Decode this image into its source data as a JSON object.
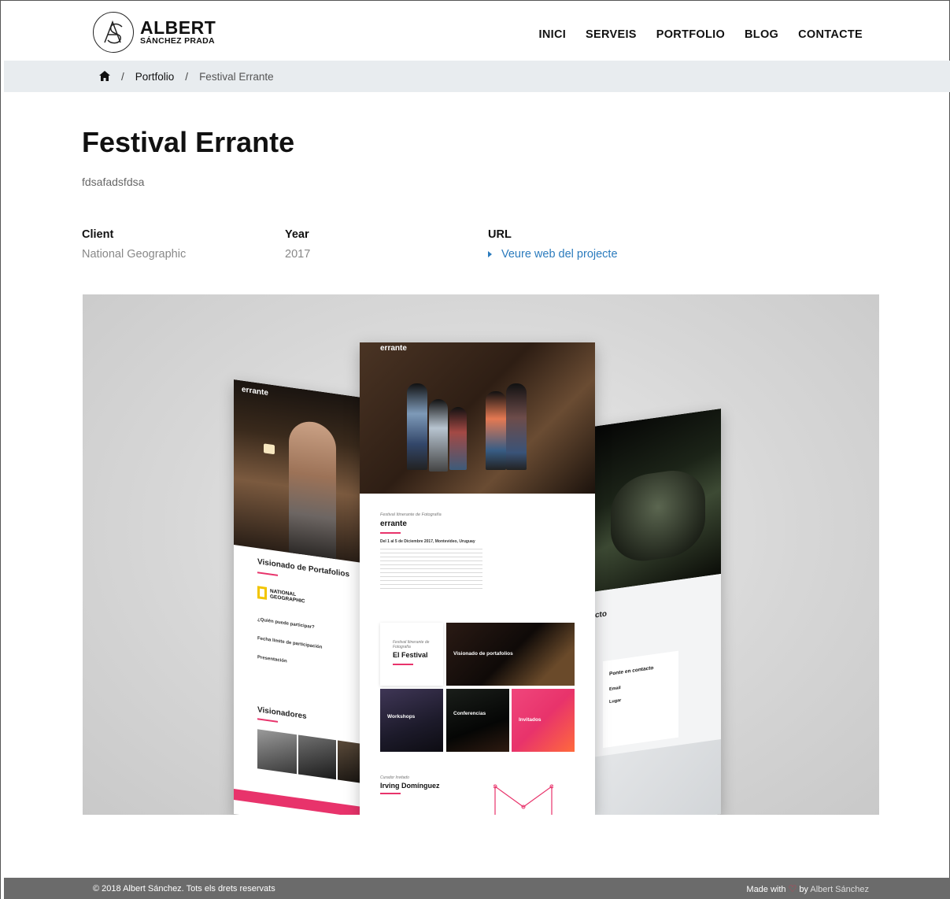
{
  "header": {
    "logo_name": "ALBERT",
    "logo_sub": "SÁNCHEZ PRADA",
    "nav": [
      "INICI",
      "SERVEIS",
      "PORTFOLIO",
      "BLOG",
      "CONTACTE"
    ]
  },
  "breadcrumb": {
    "home_icon": "home-icon",
    "sep": "/",
    "items": [
      "Portfolio",
      "Festival Errante"
    ]
  },
  "project": {
    "title": "Festival Errante",
    "subtitle": "fdsafadsfdsa",
    "client_label": "Client",
    "client_value": "National Geographic",
    "year_label": "Year",
    "year_value": "2017",
    "url_label": "URL",
    "url_link": "Veure web del projecte"
  },
  "mockup": {
    "brand": "errante",
    "center_kicker": "Festival Itinerante de Fotografía",
    "center_title": "errante",
    "center_date": "Del 1 al 5 de Diciembre 2017, Montevideo, Uruguay",
    "festival_kicker": "Festival Itinerante de Fotografía",
    "festival_title": "El Festival",
    "tile_visionado": "Visionado de portafolios",
    "tile_workshops": "Workshops",
    "tile_conferencias": "Conferencias",
    "tile_invitados": "Invitados",
    "bottom_kicker": "Curador Invitado",
    "bottom_title": "Irving Domínguez",
    "left_title": "Visionado de Portafolios",
    "left_logo": "NATIONAL GEOGRAPHIC",
    "left_q1": "¿Quién puede participar?",
    "left_q2": "Fecha límite de participación",
    "left_q3": "Presentación",
    "left_section": "Visionadores",
    "right_contact_title": "cto",
    "right_card_title": "Ponte en contacto",
    "right_email": "Email",
    "right_lugar": "Lugar",
    "accent": "#e8336b"
  },
  "footer": {
    "copyright": "© 2018 Albert Sánchez. Tots els drets reservats",
    "made_with": "Made with",
    "by": "by",
    "author": "Albert Sánchez",
    "heart_icon": "heart-icon",
    "heart_color": "#e8334b"
  }
}
